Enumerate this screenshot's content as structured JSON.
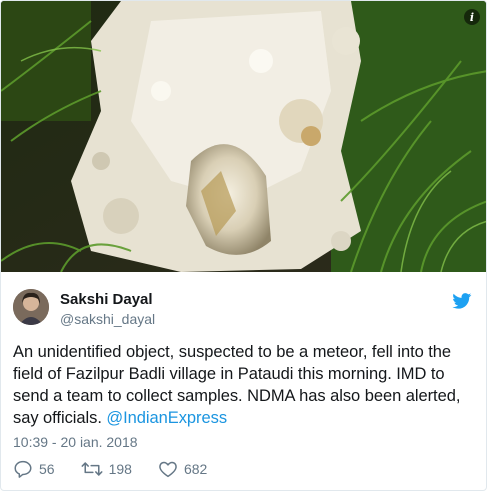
{
  "media": {
    "info_icon": "info-icon",
    "info_glyph": "i"
  },
  "tweet": {
    "author_name": "Sakshi Dayal",
    "author_handle": "@sakshi_dayal",
    "text_main": "An unidentified object, suspected to be a meteor, fell into the\nfield of Fazilpur Badli village in Pataudi this morning. IMD to\nsend a team to collect samples. NDMA has also been alerted,\nsay officials. ",
    "mention": "@IndianExpress",
    "timestamp": "10:39 - 20 ian. 2018",
    "brand_icon": "twitter-bird-icon",
    "brand_color": "#1da1f2"
  },
  "actions": {
    "replies": "56",
    "retweets": "198",
    "likes": "682"
  }
}
